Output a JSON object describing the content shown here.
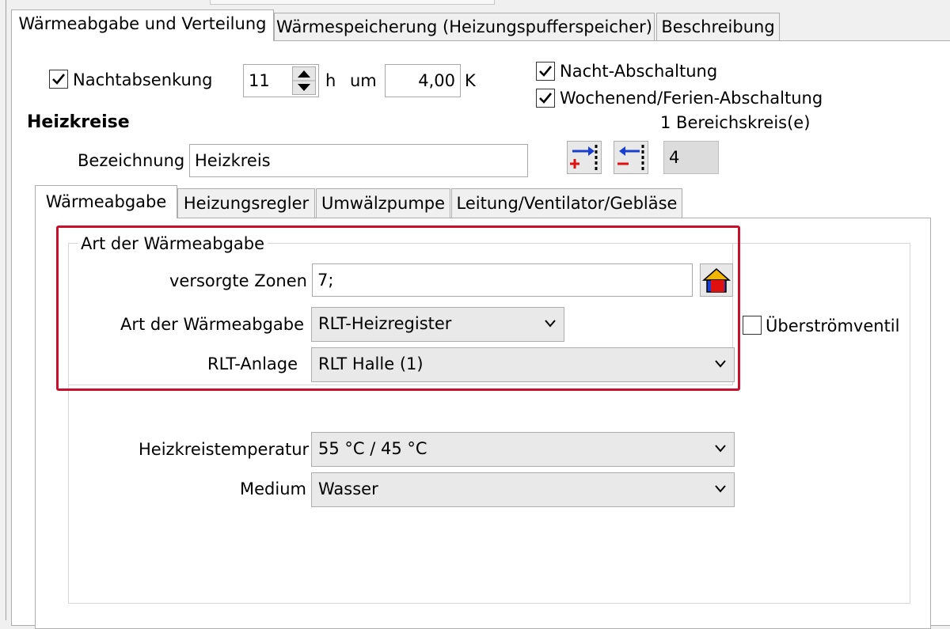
{
  "outer_tabs": [
    {
      "label": "Wärmeabgabe und Verteilung",
      "active": true
    },
    {
      "label": "Wärmespeicherung (Heizungspufferspeicher)",
      "active": false
    },
    {
      "label": "Beschreibung",
      "active": false
    }
  ],
  "night": {
    "nachtabsenkung_label": "Nachtabsenkung",
    "nachtabsenkung_checked": true,
    "hours_value": "11",
    "hours_unit": "h",
    "um_label": "um",
    "kelvin_value": "4,00",
    "kelvin_unit": "K",
    "nacht_abschaltung_label": "Nacht-Abschaltung",
    "nacht_abschaltung_checked": true,
    "wochenend_label": "Wochenend/Ferien-Abschaltung",
    "wochenend_checked": true
  },
  "heizkreise": {
    "title": "Heizkreise",
    "bereichskreis_label": "1 Bereichskreis(e)",
    "bezeichnung_label": "Bezeichnung",
    "bezeichnung_value": "Heizkreis",
    "count_value": "4"
  },
  "inner_tabs": [
    {
      "label": "Wärmeabgabe",
      "active": true
    },
    {
      "label": "Heizungsregler",
      "active": false
    },
    {
      "label": "Umwälzpumpe",
      "active": false
    },
    {
      "label": "Leitung/Ventilator/Gebläse",
      "active": false
    }
  ],
  "group": {
    "title": "Art der Wärmeabgabe",
    "zonen_label": "versorgte Zonen",
    "zonen_value": "7;",
    "art_label": "Art der Wärmeabgabe",
    "art_value": "RLT-Heizregister",
    "rlt_label": "RLT-Anlage",
    "rlt_value": "RLT Halle (1)",
    "ueberstroem_label": "Überströmventil",
    "ueberstroem_checked": false
  },
  "lower": {
    "temp_label": "Heizkreistemperatur",
    "temp_value": "55 °C / 45 °C",
    "medium_label": "Medium",
    "medium_value": "Wasser"
  },
  "colors": {
    "highlight": "#c8102e",
    "panel": "#ffffff",
    "background": "#f0f0f0"
  }
}
